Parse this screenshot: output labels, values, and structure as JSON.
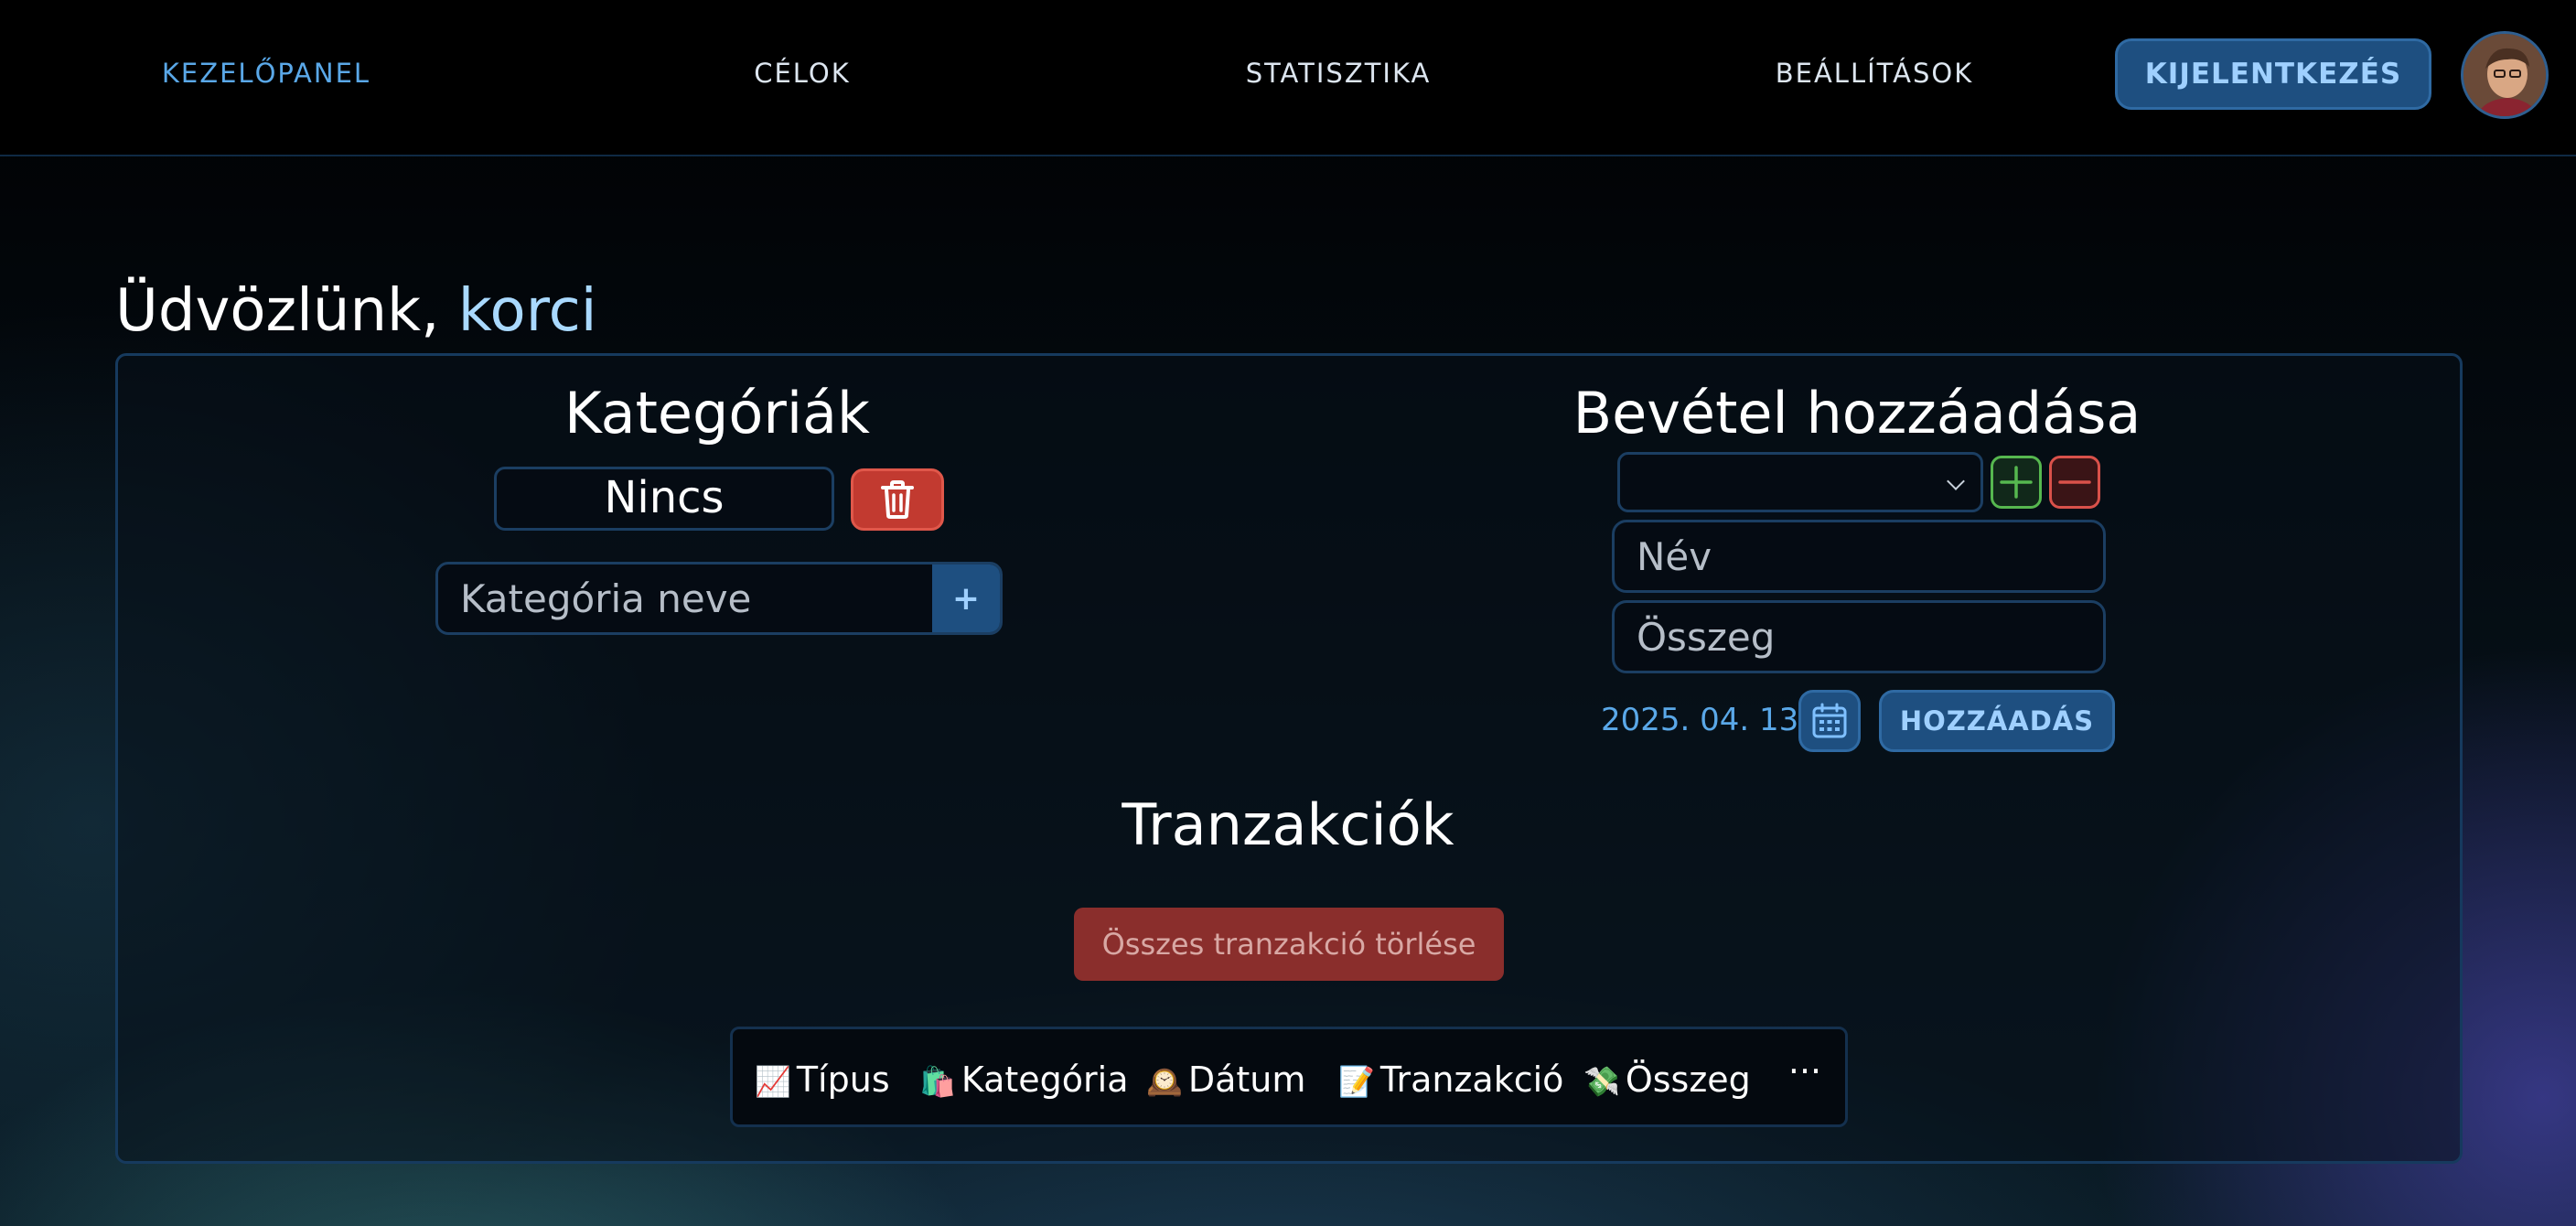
{
  "nav": {
    "dashboard": "KEZELŐPANEL",
    "goals": "CÉLOK",
    "statistics": "STATISZTIKA",
    "settings": "BEÁLLÍTÁSOK",
    "logout": "KIJELENTKEZÉS"
  },
  "welcome": {
    "greeting": "Üdvözlünk, ",
    "username": "korci"
  },
  "categories": {
    "title": "Kategóriák",
    "selected": "Nincs",
    "input_placeholder": "Kategória neve",
    "add_label": "+"
  },
  "income": {
    "title": "Bevétel hozzáadása",
    "selected": "",
    "name_placeholder": "Név",
    "amount_placeholder": "Összeg",
    "date": "2025. 04. 13.",
    "add_label": "HOZZÁADÁS"
  },
  "transactions": {
    "title": "Tranzakciók",
    "clear_all_label": "Összes tranzakció törlése",
    "columns": [
      {
        "emoji": "📈",
        "label": "Típus"
      },
      {
        "emoji": "🛍️",
        "label": "Kategória"
      },
      {
        "emoji": "🕰️",
        "label": "Dátum"
      },
      {
        "emoji": "📝",
        "label": "Tranzakció"
      },
      {
        "emoji": "💸",
        "label": "Összeg"
      }
    ],
    "more_label": "···"
  },
  "colors": {
    "accent": "#5aa8e8",
    "button_bg": "#1e4f80",
    "danger": "#c23a30",
    "success": "#56b74f"
  }
}
